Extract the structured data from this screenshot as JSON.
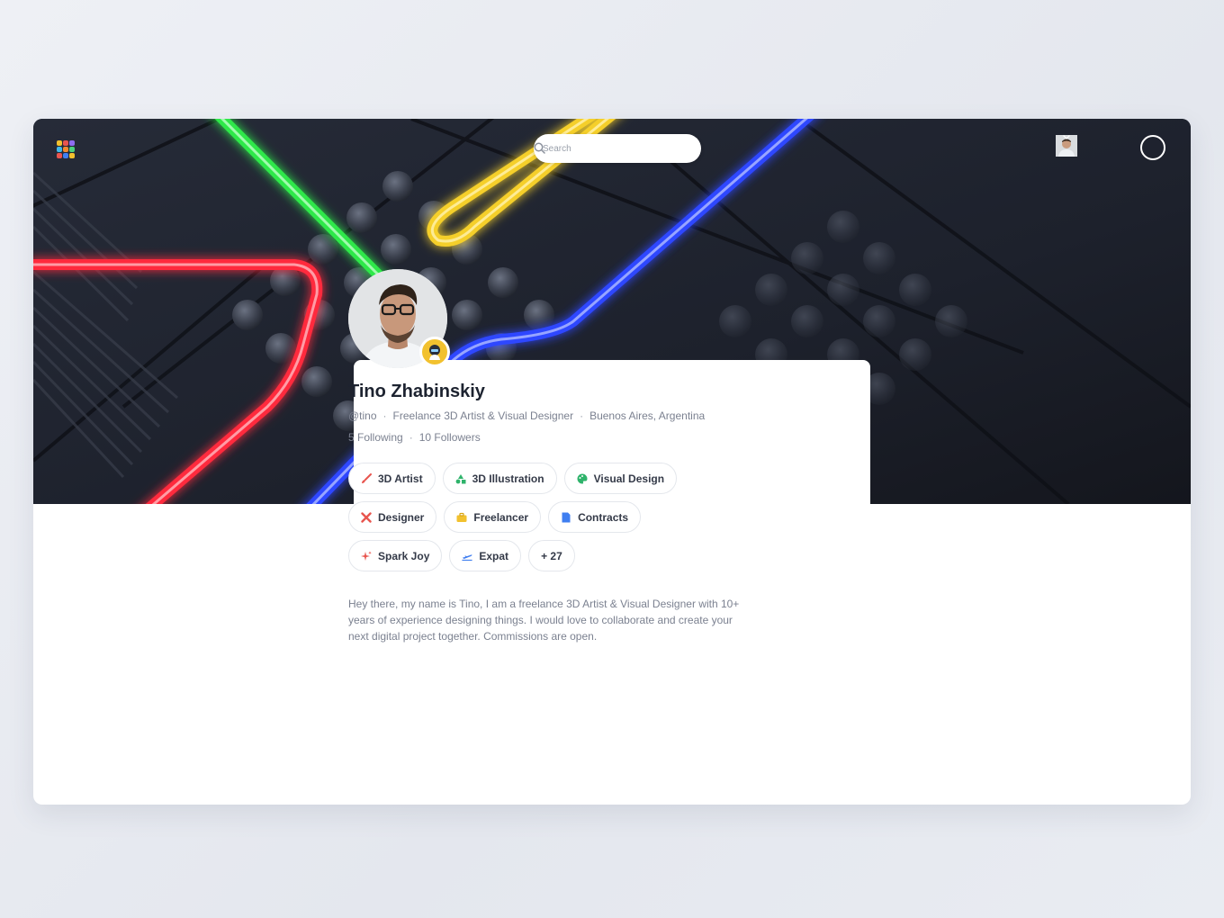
{
  "header": {
    "search": {
      "placeholder": "Search"
    },
    "icons": [
      "logo-icon",
      "mail-icon",
      "bell-icon",
      "user-avatar",
      "chevron-down-icon"
    ]
  },
  "profile": {
    "name": "Tino Zhabinskiy",
    "handle": "@tino",
    "title": "Freelance 3D Artist & Visual Designer",
    "location": "Buenos Aires, Argentina",
    "following": "5 Following",
    "followers": "10 Followers",
    "bio": "Hey there, my name is Tino, I am a freelance 3D Artist & Visual Designer with 10+ years of experience designing things. I would love to collaborate and create your next digital project together. Commissions are open."
  },
  "tags": [
    {
      "label": "3D Artist",
      "icon": "brush-icon"
    },
    {
      "label": "3D Illustration",
      "icon": "shapes-icon"
    },
    {
      "label": "Visual Design",
      "icon": "palette-icon"
    },
    {
      "label": "Designer",
      "icon": "tools-icon"
    },
    {
      "label": "Freelancer",
      "icon": "briefcase-icon"
    },
    {
      "label": "Contracts",
      "icon": "document-icon"
    },
    {
      "label": "Spark Joy",
      "icon": "sparkle-icon"
    },
    {
      "label": "Expat",
      "icon": "airplane-icon"
    },
    {
      "label": "+ 27",
      "icon": ""
    }
  ],
  "colors": {
    "accent_yellow": "#f2c12e",
    "text_dark": "#1d2330",
    "text_muted": "#7b8190"
  }
}
